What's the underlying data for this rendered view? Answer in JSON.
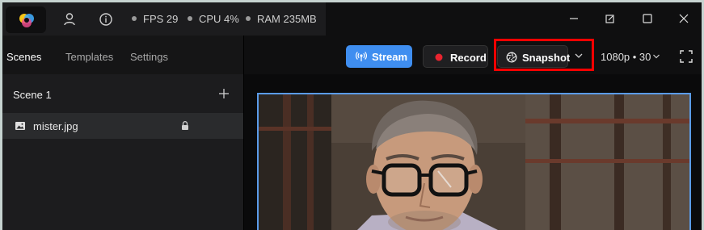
{
  "titlebar": {
    "stats": {
      "fps": "FPS 29",
      "cpu": "CPU 4%",
      "ram": "RAM 235MB"
    },
    "icons": [
      "app-logo-icon",
      "user-icon",
      "info-icon"
    ],
    "window_controls": [
      "minimize-icon",
      "restore-icon",
      "maximize-icon",
      "close-icon"
    ]
  },
  "sidebar": {
    "tabs": [
      {
        "label": "Scenes",
        "active": true
      },
      {
        "label": "Templates",
        "active": false
      },
      {
        "label": "Settings",
        "active": false
      }
    ],
    "scene_title": "Scene 1",
    "sources": [
      {
        "label": "mister.jpg",
        "icon": "image-icon",
        "locked": true
      }
    ]
  },
  "toolbar": {
    "stream_label": "Stream",
    "record_label": "Record",
    "snapshot_label": "Snapshot",
    "resolution": "1080p • 30"
  },
  "colors": {
    "accent": "#3f8ef0",
    "record_dot": "#e8242f",
    "highlight": "#ff0000",
    "canvas_border": "#5a9be8"
  }
}
